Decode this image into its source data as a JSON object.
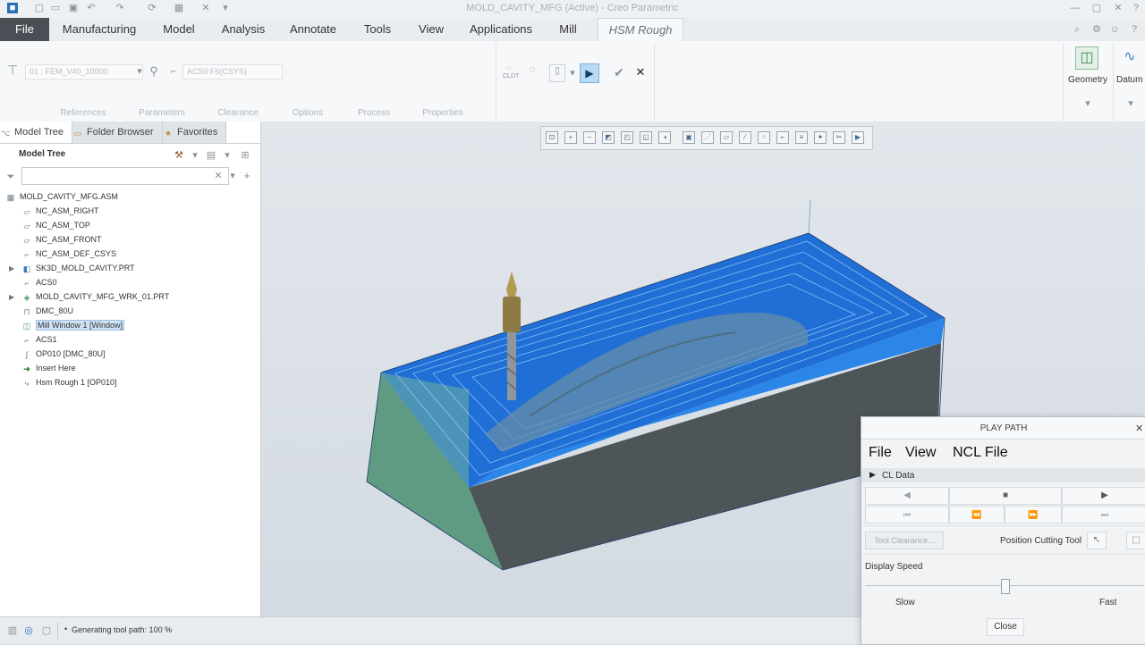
{
  "window": {
    "title": "MOLD_CAVITY_MFG (Active) - Creo Parametric"
  },
  "ribbon": {
    "tabs": [
      "File",
      "Manufacturing",
      "Model",
      "Analysis",
      "Annotate",
      "Tools",
      "View",
      "Applications",
      "Mill",
      "HSM Rough"
    ],
    "active_tab": "HSM Rough",
    "machine_select": "01 : FEM_V40_10000",
    "csys_field": "ACS0:F6(CSYS)",
    "panel_tabs": [
      "References",
      "Parameters",
      "Clearance",
      "Options",
      "Process",
      "Properties"
    ],
    "groups": {
      "geometry": "Geometry",
      "datum": "Datum"
    },
    "cldt": "CLDT"
  },
  "left_panel": {
    "tabs": [
      "Model Tree",
      "Folder Browser",
      "Favorites"
    ],
    "header": "Model Tree",
    "filter_placeholder": "",
    "tree": [
      {
        "label": "MOLD_CAVITY_MFG.ASM",
        "icon": "assembly-icon"
      },
      {
        "label": "NC_ASM_RIGHT",
        "icon": "datum-plane-icon"
      },
      {
        "label": "NC_ASM_TOP",
        "icon": "datum-plane-icon"
      },
      {
        "label": "NC_ASM_FRONT",
        "icon": "datum-plane-icon"
      },
      {
        "label": "NC_ASM_DEF_CSYS",
        "icon": "csys-icon"
      },
      {
        "label": "SK3D_MOLD_CAVITY.PRT",
        "icon": "part-icon"
      },
      {
        "label": "ACS0",
        "icon": "csys-icon"
      },
      {
        "label": "MOLD_CAVITY_MFG_WRK_01.PRT",
        "icon": "workpiece-icon"
      },
      {
        "label": "DMC_80U",
        "icon": "machine-icon"
      },
      {
        "label": "Mill Window 1 [Window]",
        "icon": "mill-window-icon"
      },
      {
        "label": "ACS1",
        "icon": "csys-icon"
      },
      {
        "label": "OP010 [DMC_80U]",
        "icon": "operation-icon"
      },
      {
        "label": "Insert Here",
        "icon": "insert-arrow-icon"
      },
      {
        "label": "Hsm Rough 1 [OP010]",
        "icon": "toolpath-icon"
      }
    ]
  },
  "status": {
    "message": "Generating tool path: 100 %"
  },
  "play_path": {
    "title": "PLAY PATH",
    "menu": [
      "File",
      "View",
      "NCL File"
    ],
    "section": "CL Data",
    "tool_clearance": "Tool Clearance...",
    "position_cutting_tool": "Position Cutting Tool",
    "display_speed": "Display Speed",
    "speed_fraction": 0.5,
    "slow": "Slow",
    "fast": "Fast",
    "close": "Close"
  },
  "colors": {
    "accent": "#4a4f55",
    "stock_blue": "#1f6fd6",
    "side_green": "#5f9a82",
    "side_dark": "#4e5559",
    "play_active": "#3e84c9"
  }
}
